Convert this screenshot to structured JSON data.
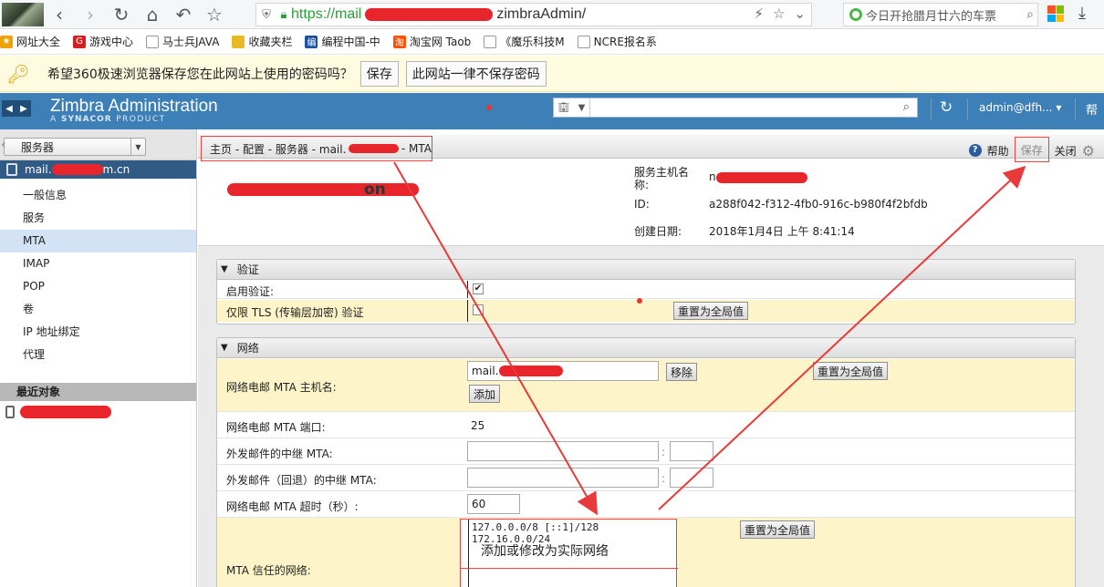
{
  "browser": {
    "url_prefix": "https://mail",
    "url_suffix": "zimbraAdmin/",
    "search_text": "今日开抢腊月廿六的车票"
  },
  "bookmarks": [
    {
      "label": "网址大全",
      "color": "#f0a000",
      "icon": "star-icon"
    },
    {
      "label": "游戏中心",
      "color": "#d42020",
      "icon": "game-icon"
    },
    {
      "label": "马士兵JAVA",
      "color": "#999999",
      "icon": "page-icon"
    },
    {
      "label": "收藏夹栏",
      "color": "#e8b923",
      "icon": "folder-icon"
    },
    {
      "label": "编程中国-中",
      "color": "#1b4fa0",
      "icon": "code-icon"
    },
    {
      "label": "淘宝网 Taob",
      "color": "#ff5000",
      "icon": "taobao-icon"
    },
    {
      "label": "《魔乐科技M",
      "color": "#999999",
      "icon": "page-icon"
    },
    {
      "label": "NCRE报名系",
      "color": "#999999",
      "icon": "page-icon"
    }
  ],
  "password_bar": {
    "message": "希望360极速浏览器保存您在此网站上使用的密码吗？",
    "save_label": "保存",
    "never_label": "此网站一律不保存密码"
  },
  "zimbra": {
    "title": "Zimbra Administration",
    "subtitle_prefix": "A",
    "subtitle_brand": "SYNACOR",
    "subtitle_suffix": "PRODUCT",
    "user": "admin@dfh...",
    "help": "帮"
  },
  "left": {
    "selector_label": "服务器",
    "server_prefix": "mail.",
    "server_suffix": "m.cn",
    "items": [
      "一般信息",
      "服务",
      "MTA",
      "IMAP",
      "POP",
      "卷",
      "IP 地址绑定",
      "代理"
    ],
    "selected_index": 2,
    "recent_header": "最近对象"
  },
  "breadcrumb": {
    "text_prefix": "主页 - 配置 - 服务器 - mail.",
    "text_suffix": "- MTA"
  },
  "toolbar": {
    "help_label": "帮助",
    "save_label": "保存",
    "close_label": "关闭"
  },
  "server_info": {
    "hostname_label_1": "服务主机名",
    "hostname_label_2": "称:",
    "hostname_value_prefix": "n",
    "id_label": "ID:",
    "id_value": "a288f042-f312-4fb0-916c-b980f4f2bfdb",
    "created_label": "创建日期:",
    "created_value": "2018年1月4日 上午 8:41:14",
    "header_text": "n",
    "header_suffix": "on"
  },
  "auth_section": {
    "title": "验证",
    "enable_label": "启用验证:",
    "enable_checked": true,
    "tls_label": "仅限 TLS (传输层加密) 验证",
    "tls_checked": false,
    "reset_label": "重置为全局值"
  },
  "network_section": {
    "title": "网络",
    "hostname_label": "网络电邮 MTA 主机名:",
    "hostname_value": "mail.",
    "remove_label": "移除",
    "add_label": "添加",
    "reset_label": "重置为全局值",
    "port_label": "网络电邮 MTA 端口:",
    "port_value": "25",
    "relay_label": "外发邮件的中继 MTA:",
    "fallback_label": "外发邮件（回退）的中继 MTA:",
    "colon": ":",
    "timeout_label": "网络电邮 MTA 超时（秒）:",
    "timeout_value": "60",
    "trusted_label": "MTA 信任的网络:",
    "trusted_value": "127.0.0.0/8 [::1]/128 172.16.0.0/24",
    "trusted_reset_label": "重置为全局值"
  },
  "annotation": {
    "note": "添加或修改为实际网络",
    "color": "#e83a3a"
  }
}
